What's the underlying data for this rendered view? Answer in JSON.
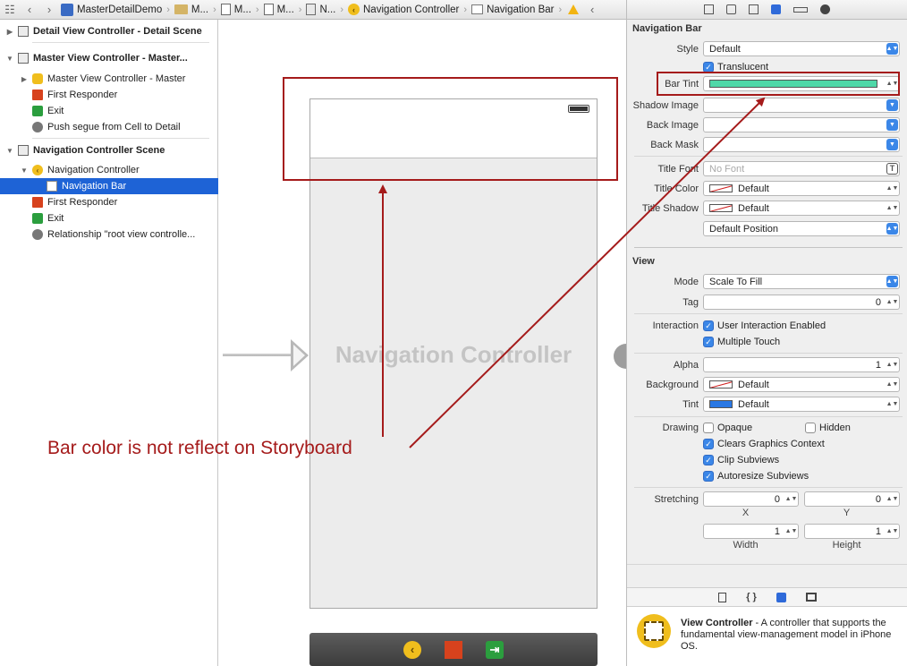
{
  "breadcrumb": {
    "items": [
      "MasterDetailDemo",
      "M...",
      "M...",
      "M...",
      "N...",
      "Navigation Controller",
      "Navigation Bar"
    ]
  },
  "outline": {
    "rows": [
      {
        "label": "Detail View Controller - Detail Scene",
        "icon": "scene-icon"
      },
      {
        "label": "Master View Controller - Master...",
        "icon": "scene-icon"
      },
      {
        "label": "Master View Controller - Master",
        "icon": "view-controller-icon"
      },
      {
        "label": "First Responder",
        "icon": "first-responder-icon"
      },
      {
        "label": "Exit",
        "icon": "exit-icon"
      },
      {
        "label": "Push segue from Cell to Detail",
        "icon": "segue-icon"
      },
      {
        "label": "Navigation Controller Scene",
        "icon": "scene-icon"
      },
      {
        "label": "Navigation Controller",
        "icon": "navigation-controller-icon"
      },
      {
        "label": "Navigation Bar",
        "icon": "navigation-bar-icon"
      },
      {
        "label": "First Responder",
        "icon": "first-responder-icon"
      },
      {
        "label": "Exit",
        "icon": "exit-icon"
      },
      {
        "label": "Relationship \"root view controlle...",
        "icon": "relationship-icon"
      }
    ]
  },
  "canvas": {
    "scene_label": "Navigation Controller",
    "annotation": "Bar color is not reflect on Storyboard",
    "annotation_color": "#a51b1b"
  },
  "inspector": {
    "navigation_bar_section": "Navigation Bar",
    "style_label": "Style",
    "style_value": "Default",
    "translucent_label": "Translucent",
    "translucent_checked": true,
    "bar_tint_label": "Bar Tint",
    "bar_tint_color": "#4fd8a8",
    "shadow_image_label": "Shadow Image",
    "back_image_label": "Back Image",
    "back_mask_label": "Back Mask",
    "title_font_label": "Title Font",
    "title_font_placeholder": "No Font",
    "title_color_label": "Title Color",
    "title_color_value": "Default",
    "title_shadow_label": "Title Shadow",
    "title_shadow_value": "Default",
    "title_position_value": "Default Position",
    "view_section": "View",
    "mode_label": "Mode",
    "mode_value": "Scale To Fill",
    "tag_label": "Tag",
    "tag_value": "0",
    "interaction_label": "Interaction",
    "user_interaction_label": "User Interaction Enabled",
    "multiple_touch_label": "Multiple Touch",
    "alpha_label": "Alpha",
    "alpha_value": "1",
    "background_label": "Background",
    "background_value": "Default",
    "tint_label": "Tint",
    "tint_value": "Default",
    "tint_color": "#2a78e4",
    "drawing_label": "Drawing",
    "opaque_label": "Opaque",
    "hidden_label": "Hidden",
    "clears_graphics_label": "Clears Graphics Context",
    "clip_subviews_label": "Clip Subviews",
    "autoresize_label": "Autoresize Subviews",
    "stretching_label": "Stretching",
    "stretch_x_value": "0",
    "stretch_y_value": "0",
    "stretch_x_caption": "X",
    "stretch_y_caption": "Y",
    "stretch_width_value": "1",
    "stretch_height_value": "1",
    "stretch_width_caption": "Width",
    "stretch_height_caption": "Height"
  },
  "library": {
    "item_title": "View Controller",
    "item_description": " - A controller that supports the fundamental view-management model in iPhone OS."
  }
}
